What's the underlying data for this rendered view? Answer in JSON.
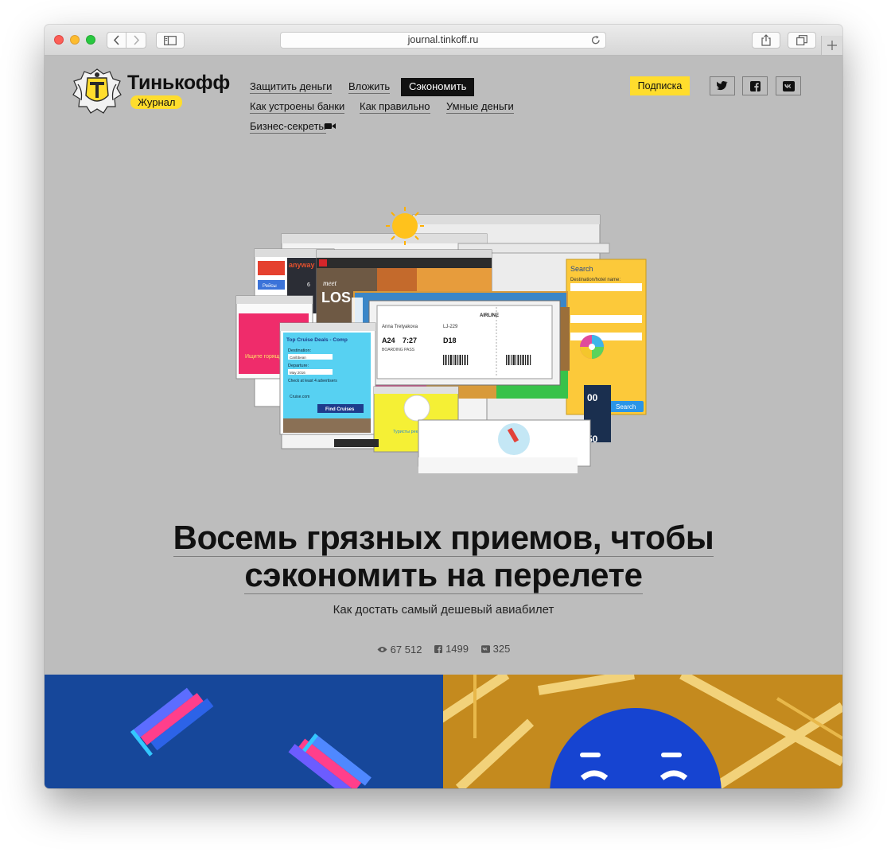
{
  "browser": {
    "address": "journal.tinkoff.ru",
    "icons": [
      "back-icon",
      "forward-icon",
      "sidebar-icon",
      "reload-icon",
      "share-icon",
      "tabs-icon",
      "plus-icon"
    ]
  },
  "header": {
    "brand": "Тинькофф",
    "badge": "Журнал",
    "nav": [
      {
        "label": "Защитить деньги"
      },
      {
        "label": "Вложить"
      },
      {
        "label": "Сэкономить",
        "active": true
      },
      {
        "label": "Как устроены банки"
      },
      {
        "label": "Как правильно"
      },
      {
        "label": "Умные деньги"
      },
      {
        "label": "Бизнес-секреты"
      }
    ],
    "subscribe": "Подписка",
    "social": [
      "twitter-icon",
      "facebook-icon",
      "vk-icon"
    ],
    "accent": "#ffdd2d"
  },
  "hero": {
    "cruise_title": "Top Cruise Deals - Comp",
    "destination_label": "Destination:",
    "destination_value": "Caribbean",
    "departure_label": "Departure:",
    "departure_value": "May 2016",
    "advertisers_label": "Check at least 4 advertisers",
    "find_button": "Find Cruises",
    "cruise_site": "Cruise.com",
    "search_title": "Search",
    "search_field_label": "Destination/hotel name:",
    "search_button": "Search",
    "boarding_airline": "AIRLINE",
    "boarding_passenger": "Anna Tretyakova",
    "boarding_flight": "LJ-229",
    "boarding_gate": "A24",
    "boarding_time": "7:27",
    "boarding_seat": "D18",
    "boarding_caption": "BOARDING PASS",
    "promo_banner": "Ищите горящие",
    "tourists_banner": "Туристы рекомендуют",
    "la_text": "LOS",
    "la_meet": "meet",
    "anyway": "anyway",
    "price1": "00",
    "price2": "50"
  },
  "article": {
    "title_line1": "Восемь грязных приемов, чтобы",
    "title_line2": "сэкономить на перелете",
    "subtitle": "Как достать самый дешевый авиабилет",
    "views": "67 512",
    "fb_shares": "1499",
    "vk_shares": "325"
  },
  "tiles": {
    "left_color": "#16479a",
    "right_color": "#c58c1c"
  }
}
